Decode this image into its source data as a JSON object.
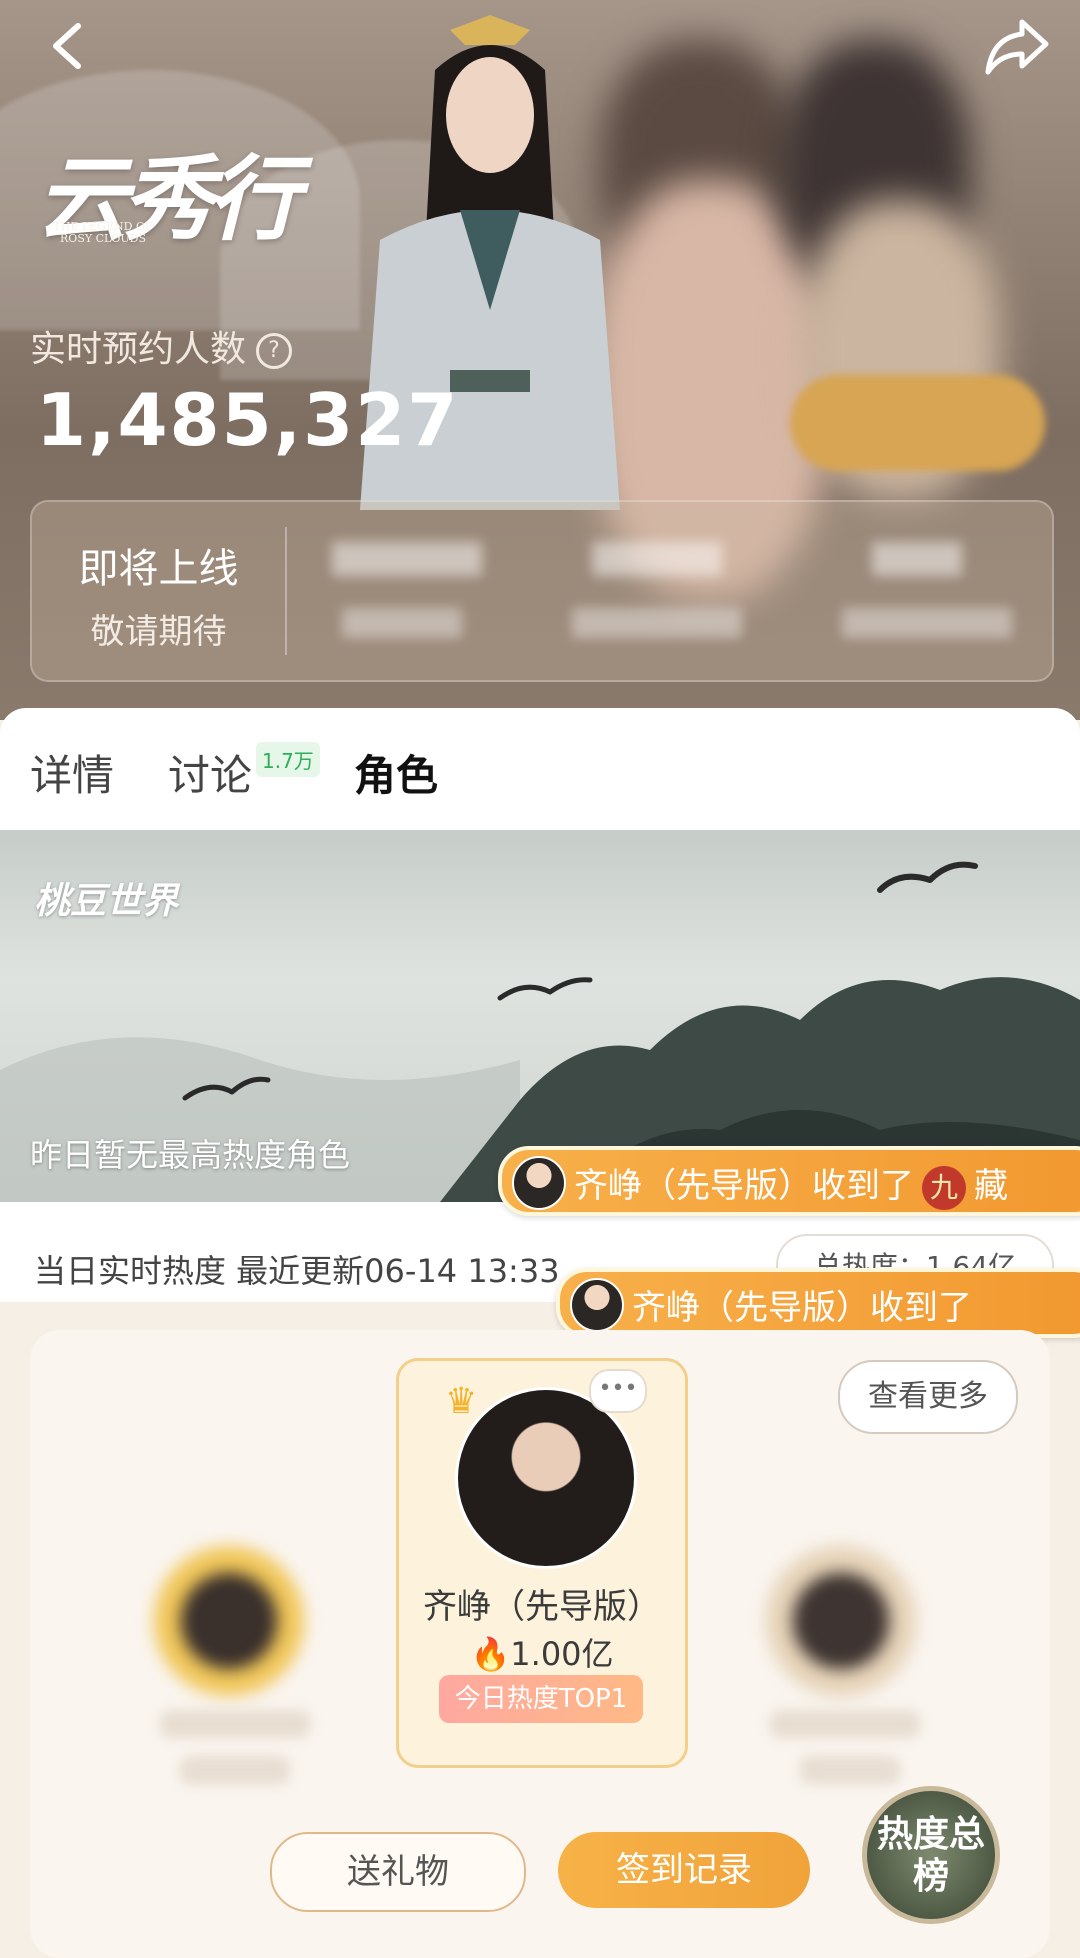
{
  "header": {
    "logo_cn": "云秀行",
    "logo_en": "THE LEGEND OF ROSY CLOUDS",
    "reservation_label": "实时预约人数",
    "reservation_count": "1,485,327",
    "status_title": "即将上线",
    "status_subtitle": "敬请期待"
  },
  "tabs": [
    {
      "label": "详情"
    },
    {
      "label": "讨论",
      "badge": "1.7万"
    },
    {
      "label": "角色"
    }
  ],
  "banner": {
    "brand": "桃豆世界",
    "note": "昨日暂无最高热度角色"
  },
  "gift_notices": [
    {
      "text": "齐峥（先导版）收到了",
      "extra": "藏"
    },
    {
      "text": "齐峥（先导版）收到了"
    }
  ],
  "heat": {
    "label": "当日实时热度 最近更新06-14 13:33",
    "total_label": "总热度：1.64亿",
    "more_button": "查看更多"
  },
  "top_role": {
    "name": "齐峥（先导版）",
    "heat": "1.00亿",
    "tag": "今日热度TOP1"
  },
  "actions": {
    "send_gift": "送礼物",
    "checkin_record": "签到记录",
    "heat_board": "热度总榜"
  },
  "colors": {
    "accent": "#f0a33a",
    "badge_green": "#2fae5a",
    "card_border": "#f2cf8b"
  }
}
